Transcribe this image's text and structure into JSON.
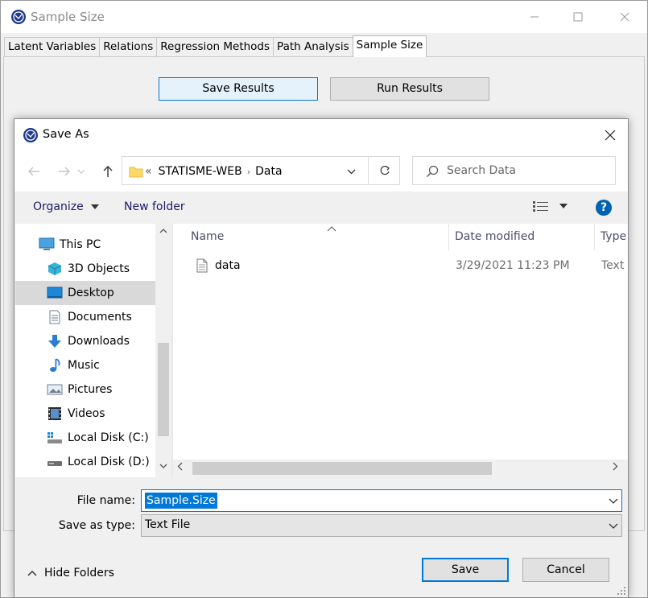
{
  "app": {
    "title": "Sample Size",
    "tabs": [
      "Latent Variables",
      "Relations",
      "Regression Methods",
      "Path Analysis",
      "Sample Size"
    ],
    "active_tab": 4,
    "buttons": {
      "save": "Save Results",
      "run": "Run Results"
    }
  },
  "dialog": {
    "title": "Save As",
    "address": {
      "overflow": "«",
      "parts": [
        "STATISME-WEB",
        "Data"
      ]
    },
    "search": {
      "placeholder": "Search Data"
    },
    "toolbar": {
      "organize": "Organize",
      "new_folder": "New folder",
      "help": "?"
    },
    "nav_items": [
      {
        "label": "This PC",
        "icon": "pc-icon"
      },
      {
        "label": "3D Objects",
        "icon": "cube-icon"
      },
      {
        "label": "Desktop",
        "icon": "desktop-icon",
        "selected": true
      },
      {
        "label": "Documents",
        "icon": "document-icon"
      },
      {
        "label": "Downloads",
        "icon": "download-icon"
      },
      {
        "label": "Music",
        "icon": "music-icon"
      },
      {
        "label": "Pictures",
        "icon": "picture-icon"
      },
      {
        "label": "Videos",
        "icon": "video-icon"
      },
      {
        "label": "Local Disk (C:)",
        "icon": "drive-c-icon"
      },
      {
        "label": "Local Disk (D:)",
        "icon": "drive-d-icon"
      }
    ],
    "columns": {
      "name": "Name",
      "date": "Date modified",
      "type": "Type"
    },
    "files": [
      {
        "name": "data",
        "date": "3/29/2021 11:23 PM",
        "type": "Text D"
      }
    ],
    "file_name": {
      "label": "File name:",
      "value": "Sample.Size"
    },
    "save_type": {
      "label": "Save as type:",
      "value": "Text File"
    },
    "hide_folders": "Hide Folders",
    "save": "Save",
    "cancel": "Cancel"
  }
}
